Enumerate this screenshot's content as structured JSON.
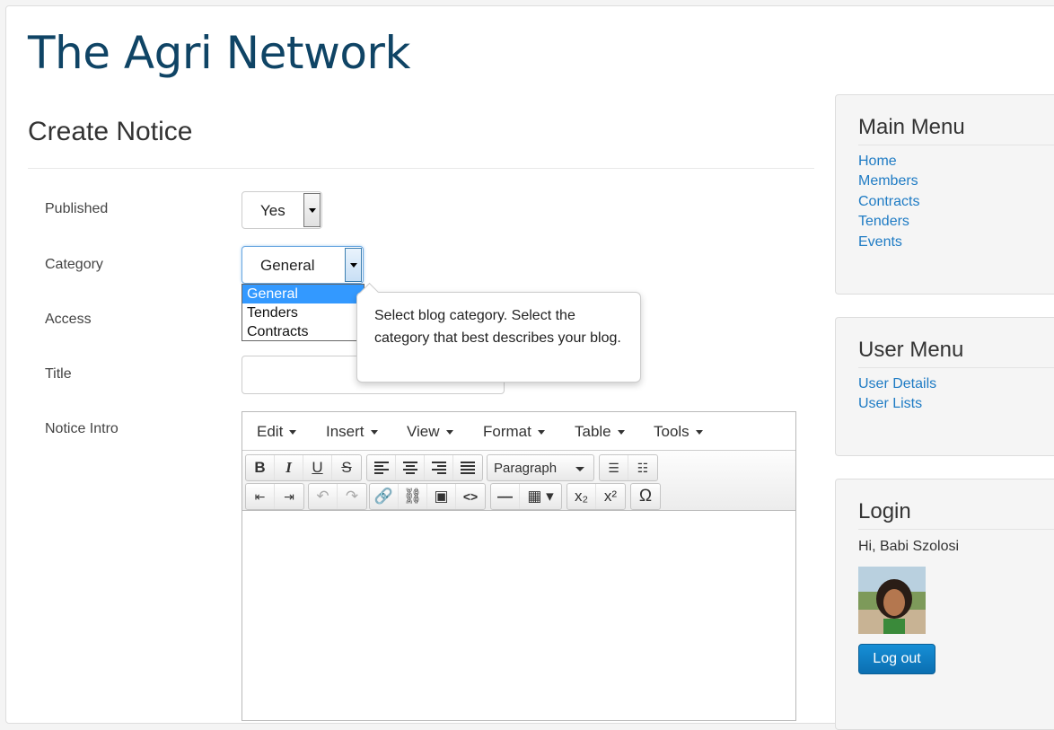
{
  "site": {
    "title": "The Agri Network"
  },
  "form": {
    "heading": "Create Notice",
    "published": {
      "label": "Published",
      "value": "Yes"
    },
    "category": {
      "label": "Category",
      "value": "General",
      "options": [
        "General",
        "Tenders",
        "Contracts"
      ],
      "tooltip": "Select blog category. Select the category that best describes your blog."
    },
    "access": {
      "label": "Access"
    },
    "title": {
      "label": "Title",
      "value": ""
    },
    "intro": {
      "label": "Notice Intro"
    }
  },
  "editor": {
    "menus": [
      "Edit",
      "Insert",
      "View",
      "Format",
      "Table",
      "Tools"
    ],
    "format_select": "Paragraph",
    "buttons": {
      "bold": "B",
      "italic": "I",
      "underline": "U",
      "strike": "S",
      "link": "link-icon",
      "unlink": "unlink-icon",
      "image": "image-icon",
      "code": "<>",
      "hr": "—",
      "subscript": "x₂",
      "superscript": "x²",
      "special": "Ω"
    }
  },
  "sidebar": {
    "main_menu": {
      "title": "Main Menu",
      "items": [
        "Home",
        "Members",
        "Contracts",
        "Tenders",
        "Events"
      ]
    },
    "user_menu": {
      "title": "User Menu",
      "items": [
        "User Details",
        "User Lists"
      ]
    },
    "login": {
      "title": "Login",
      "greeting": "Hi, Babi Szolosi",
      "logout_label": "Log out"
    }
  },
  "colors": {
    "title": "#0f4465",
    "link": "#1e7bc4",
    "button": "#0b6fb1",
    "selected": "#3399ff"
  }
}
